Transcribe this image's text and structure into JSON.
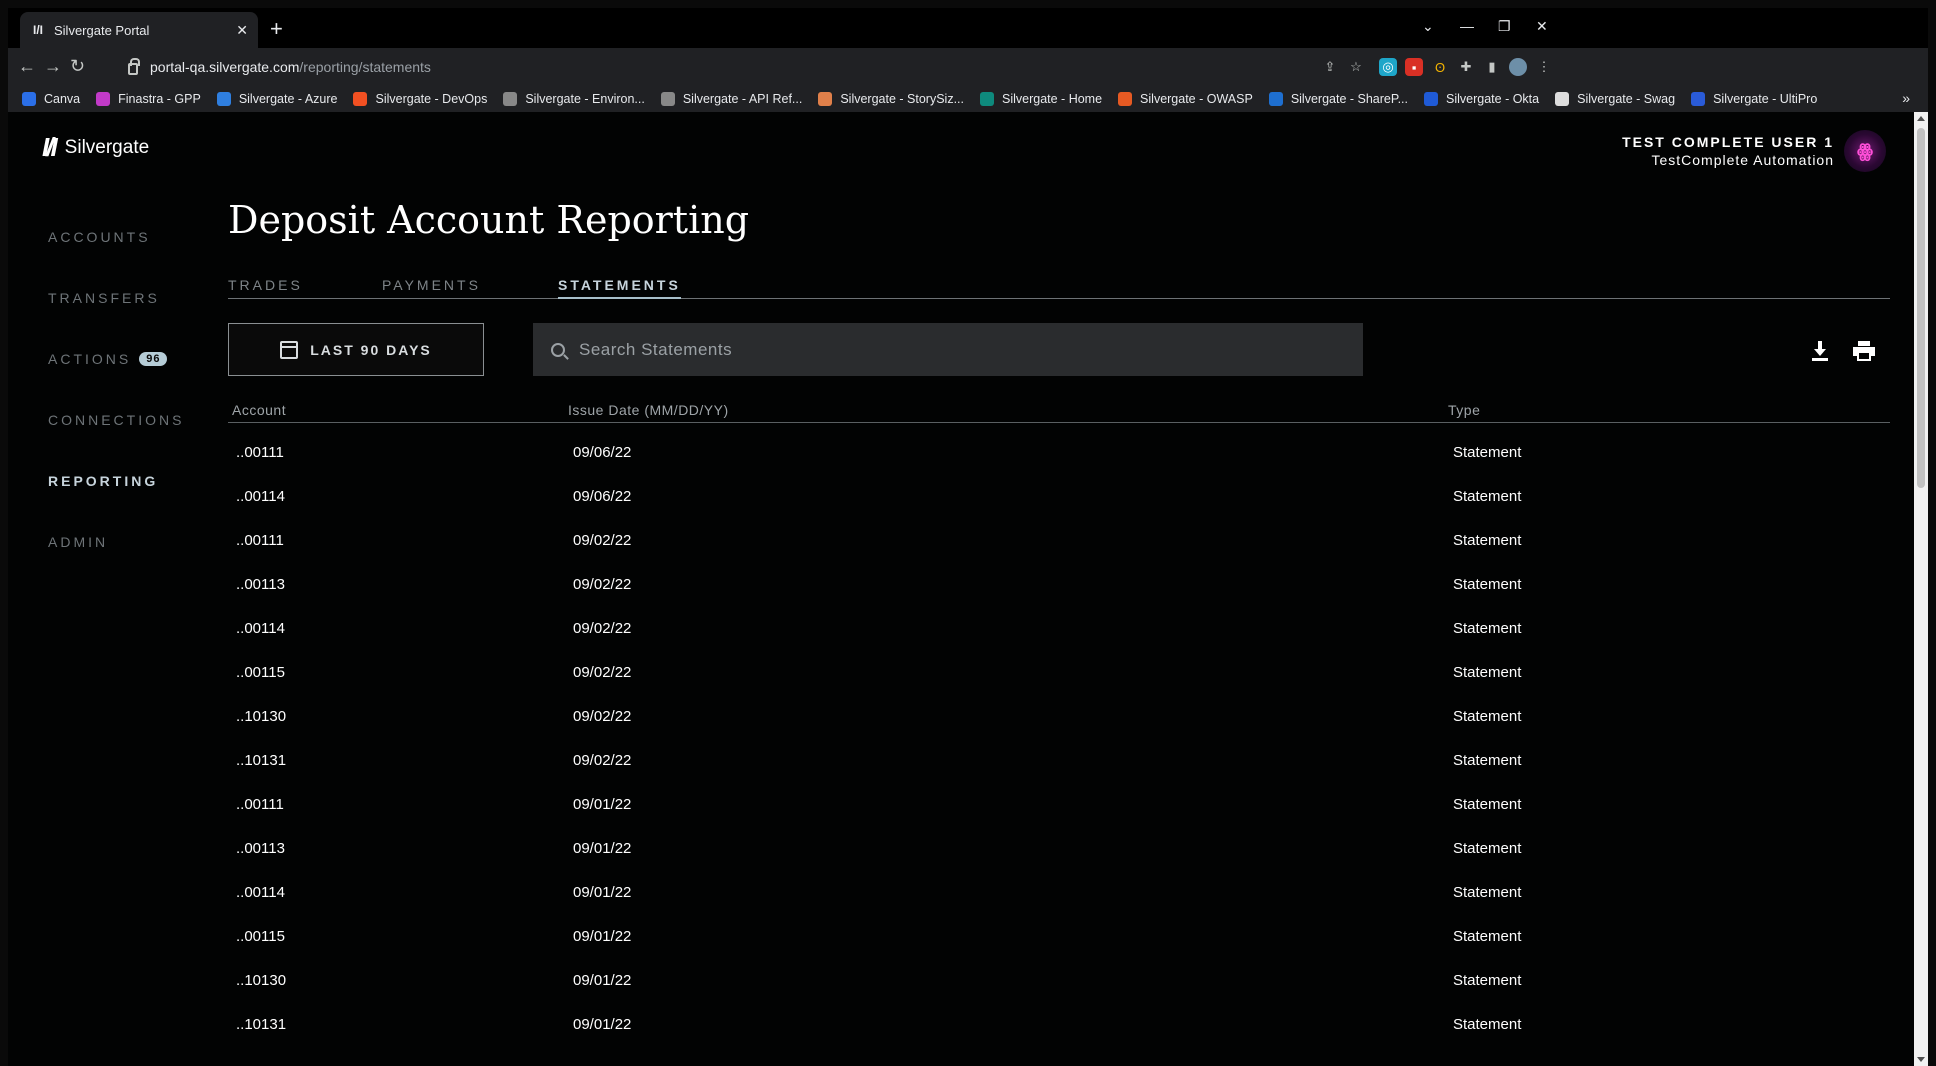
{
  "browser": {
    "tab_title": "Silvergate Portal",
    "tab_favicon": "I/I",
    "new_tab": "+",
    "url_host": "portal-qa.silvergate.com",
    "url_path": "/reporting/statements",
    "bookmarks": [
      {
        "label": "Canva",
        "color": "#2b6fe8"
      },
      {
        "label": "Finastra - GPP",
        "color": "#c13ac8"
      },
      {
        "label": "Silvergate - Azure",
        "color": "#2f7fe0"
      },
      {
        "label": "Silvergate - DevOps",
        "color": "#f25022"
      },
      {
        "label": "Silvergate - Environ...",
        "color": "#888888"
      },
      {
        "label": "Silvergate - API Ref...",
        "color": "#888888"
      },
      {
        "label": "Silvergate - StorySiz...",
        "color": "#e0804a"
      },
      {
        "label": "Silvergate - Home",
        "color": "#0e8a7d"
      },
      {
        "label": "Silvergate - OWASP",
        "color": "#e65a23"
      },
      {
        "label": "Silvergate - ShareP...",
        "color": "#1e6fd0"
      },
      {
        "label": "Silvergate - Okta",
        "color": "#1f5ad6"
      },
      {
        "label": "Silvergate - Swag",
        "color": "#dddddd"
      },
      {
        "label": "Silvergate - UltiPro",
        "color": "#2a5bd8"
      }
    ],
    "bookmarks_more": "»"
  },
  "app": {
    "logo_text": "Silvergate",
    "logo_mark": "I/I",
    "nav": [
      {
        "label": "ACCOUNTS",
        "active": false
      },
      {
        "label": "TRANSFERS",
        "active": false
      },
      {
        "label": "ACTIONS",
        "active": false,
        "badge": "96"
      },
      {
        "label": "CONNECTIONS",
        "active": false
      },
      {
        "label": "REPORTING",
        "active": true
      },
      {
        "label": "ADMIN",
        "active": false
      }
    ],
    "user": {
      "name": "TEST COMPLETE USER 1",
      "org": "TestComplete Automation"
    },
    "page_title": "Deposit Account Reporting",
    "tabs": [
      {
        "label": "TRADES",
        "active": false
      },
      {
        "label": "PAYMENTS",
        "active": false
      },
      {
        "label": "STATEMENTS",
        "active": true
      }
    ],
    "date_filter_label": "LAST 90 DAYS",
    "search_placeholder": "Search Statements",
    "table": {
      "columns": [
        "Account",
        "Issue Date (MM/DD/YY)",
        "Type"
      ],
      "rows": [
        [
          "..00111",
          "09/06/22",
          "Statement"
        ],
        [
          "..00114",
          "09/06/22",
          "Statement"
        ],
        [
          "..00111",
          "09/02/22",
          "Statement"
        ],
        [
          "..00113",
          "09/02/22",
          "Statement"
        ],
        [
          "..00114",
          "09/02/22",
          "Statement"
        ],
        [
          "..00115",
          "09/02/22",
          "Statement"
        ],
        [
          "..10130",
          "09/02/22",
          "Statement"
        ],
        [
          "..10131",
          "09/02/22",
          "Statement"
        ],
        [
          "..00111",
          "09/01/22",
          "Statement"
        ],
        [
          "..00113",
          "09/01/22",
          "Statement"
        ],
        [
          "..00114",
          "09/01/22",
          "Statement"
        ],
        [
          "..00115",
          "09/01/22",
          "Statement"
        ],
        [
          "..10130",
          "09/01/22",
          "Statement"
        ],
        [
          "..10131",
          "09/01/22",
          "Statement"
        ]
      ]
    }
  }
}
